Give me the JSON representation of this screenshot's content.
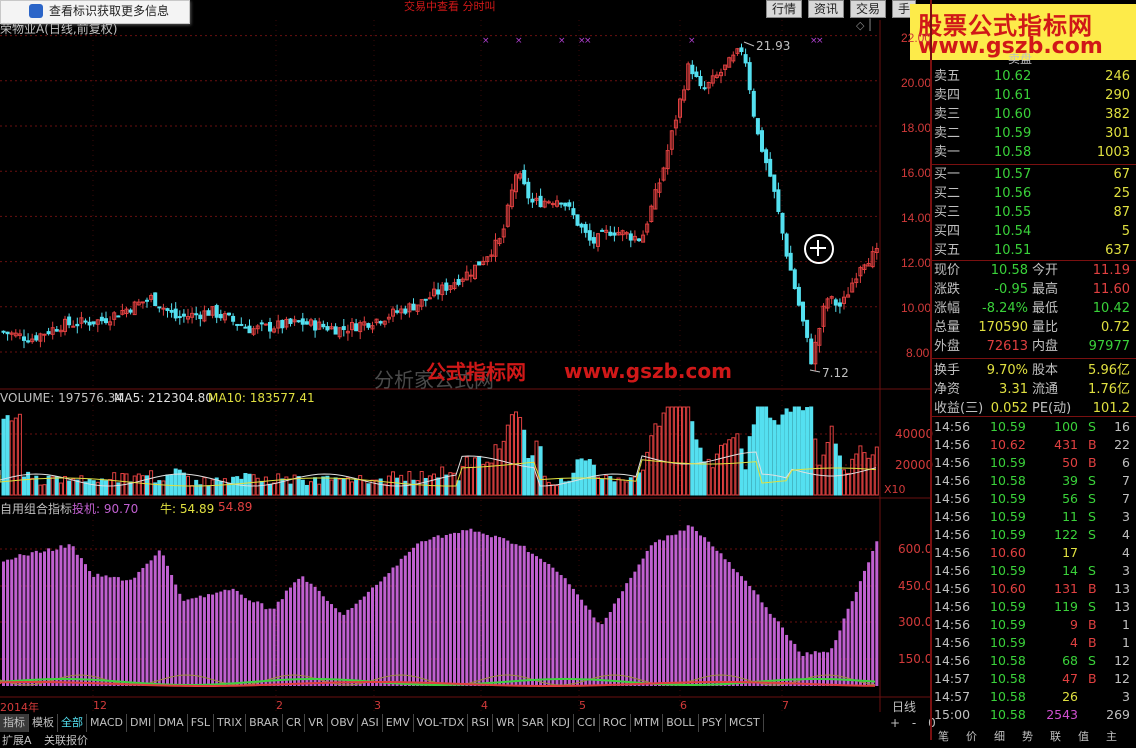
{
  "toast": {
    "text": "查看标识获取更多信息"
  },
  "top_tabs": [
    "行情",
    "资讯",
    "交易",
    "手"
  ],
  "top_center_text": "交易中查看  分时叫",
  "chart_title": "荣物业A(日线,前复权)",
  "watermark": {
    "line1": "股票公式指标网",
    "line2": "www.gszb.com"
  },
  "center_watermark": {
    "text1": "分析家公式网",
    "text2": "公式指标网",
    "text3": "www.gszb.com"
  },
  "price_axis": {
    "ticks": [
      "22.00",
      "20.00",
      "18.00",
      "16.00",
      "14.00",
      "12.00",
      "10.00",
      "8.00"
    ],
    "max_label": "21.93",
    "min_label": "7.12"
  },
  "volume_panel": {
    "label": "VOLUME: 197576.34",
    "ma5": "MA5: 212304.80",
    "ma10": "MA10: 183577.41",
    "ticks": [
      "40000",
      "20000"
    ],
    "unit": "X10"
  },
  "indicator_panel": {
    "name": "自用组合指标",
    "tj_label": "投机: 90.70",
    "niu_label": "牛: 54.89",
    "niu2": "54.89",
    "ticks": [
      "600.0",
      "450.0",
      "300.0",
      "150.0"
    ]
  },
  "x_axis": {
    "labels": [
      "2014年",
      "12",
      "2",
      "3",
      "4",
      "5",
      "6",
      "7"
    ],
    "period": "日线"
  },
  "bottom_tabs": [
    "指标",
    "模板",
    "全部",
    "MACD",
    "DMI",
    "DMA",
    "FSL",
    "TRIX",
    "BRAR",
    "CR",
    "VR",
    "OBV",
    "ASI",
    "EMV",
    "VOL-TDX",
    "RSI",
    "WR",
    "SAR",
    "KDJ",
    "CCI",
    "ROC",
    "MTM",
    "BOLL",
    "PSY",
    "MCST"
  ],
  "bottom_controls": [
    "+",
    "-",
    "0"
  ],
  "bottom_row2": [
    "扩展A",
    "关联报价"
  ],
  "right_bottom_tabs": [
    "笔",
    "价",
    "细",
    "势",
    "联",
    "值",
    "主"
  ],
  "order_book": {
    "asks": [
      {
        "label": "卖五",
        "price": "10.62",
        "vol": "246"
      },
      {
        "label": "卖四",
        "price": "10.61",
        "vol": "290"
      },
      {
        "label": "卖三",
        "price": "10.60",
        "vol": "382"
      },
      {
        "label": "卖二",
        "price": "10.59",
        "vol": "301"
      },
      {
        "label": "卖一",
        "price": "10.58",
        "vol": "1003"
      }
    ],
    "bids": [
      {
        "label": "买一",
        "price": "10.57",
        "vol": "67"
      },
      {
        "label": "买二",
        "price": "10.56",
        "vol": "25"
      },
      {
        "label": "买三",
        "price": "10.55",
        "vol": "87"
      },
      {
        "label": "买四",
        "price": "10.54",
        "vol": "5"
      },
      {
        "label": "买五",
        "price": "10.51",
        "vol": "637"
      }
    ],
    "ask_header": "卖盘"
  },
  "stats": [
    {
      "l1": "现价",
      "v1": "10.58",
      "c1": "#3ad23a",
      "l2": "今开",
      "v2": "11.19",
      "c2": "#e04040"
    },
    {
      "l1": "涨跌",
      "v1": "-0.95",
      "c1": "#3ad23a",
      "l2": "最高",
      "v2": "11.60",
      "c2": "#e04040"
    },
    {
      "l1": "涨幅",
      "v1": "-8.24%",
      "c1": "#3ad23a",
      "l2": "最低",
      "v2": "10.42",
      "c2": "#3ad23a"
    },
    {
      "l1": "总量",
      "v1": "170590",
      "c1": "#e0e040",
      "l2": "量比",
      "v2": "0.72",
      "c2": "#e0e040"
    },
    {
      "l1": "外盘",
      "v1": "72613",
      "c1": "#e04040",
      "l2": "内盘",
      "v2": "97977",
      "c2": "#3ad23a"
    },
    {
      "l1": "换手",
      "v1": "9.70%",
      "c1": "#e0e040",
      "l2": "股本",
      "v2": "5.96亿",
      "c2": "#e0e040"
    },
    {
      "l1": "净资",
      "v1": "3.31",
      "c1": "#e0e040",
      "l2": "流通",
      "v2": "1.76亿",
      "c2": "#e0e040"
    },
    {
      "l1": "收益(三)",
      "v1": "0.052",
      "c1": "#e0e040",
      "l2": "PE(动)",
      "v2": "101.2",
      "c2": "#e0e040"
    }
  ],
  "ticks": [
    {
      "t": "14:56",
      "p": "10.59",
      "v": "100",
      "d": "S",
      "n": "16"
    },
    {
      "t": "14:56",
      "p": "10.62",
      "v": "431",
      "d": "B",
      "n": "22"
    },
    {
      "t": "14:56",
      "p": "10.59",
      "v": "50",
      "d": "B",
      "n": "6"
    },
    {
      "t": "14:56",
      "p": "10.58",
      "v": "39",
      "d": "S",
      "n": "7"
    },
    {
      "t": "14:56",
      "p": "10.59",
      "v": "56",
      "d": "S",
      "n": "7"
    },
    {
      "t": "14:56",
      "p": "10.59",
      "v": "11",
      "d": "S",
      "n": "3"
    },
    {
      "t": "14:56",
      "p": "10.59",
      "v": "122",
      "d": "S",
      "n": "4"
    },
    {
      "t": "14:56",
      "p": "10.60",
      "v": "17",
      "d": "",
      "n": "4"
    },
    {
      "t": "14:56",
      "p": "10.59",
      "v": "14",
      "d": "S",
      "n": "3"
    },
    {
      "t": "14:56",
      "p": "10.60",
      "v": "131",
      "d": "B",
      "n": "13"
    },
    {
      "t": "14:56",
      "p": "10.59",
      "v": "119",
      "d": "S",
      "n": "13"
    },
    {
      "t": "14:56",
      "p": "10.59",
      "v": "9",
      "d": "B",
      "n": "1"
    },
    {
      "t": "14:56",
      "p": "10.59",
      "v": "4",
      "d": "B",
      "n": "1"
    },
    {
      "t": "14:56",
      "p": "10.58",
      "v": "68",
      "d": "S",
      "n": "12"
    },
    {
      "t": "14:57",
      "p": "10.58",
      "v": "47",
      "d": "B",
      "n": "12"
    },
    {
      "t": "14:57",
      "p": "10.58",
      "v": "26",
      "d": "",
      "n": "3"
    },
    {
      "t": "15:00",
      "p": "10.58",
      "v": "2543",
      "d": "",
      "n": "269"
    }
  ],
  "colors": {
    "up": "#e04040",
    "down": "#54e0f0",
    "grid": "#6a1010",
    "indicator": "#c060d0"
  }
}
